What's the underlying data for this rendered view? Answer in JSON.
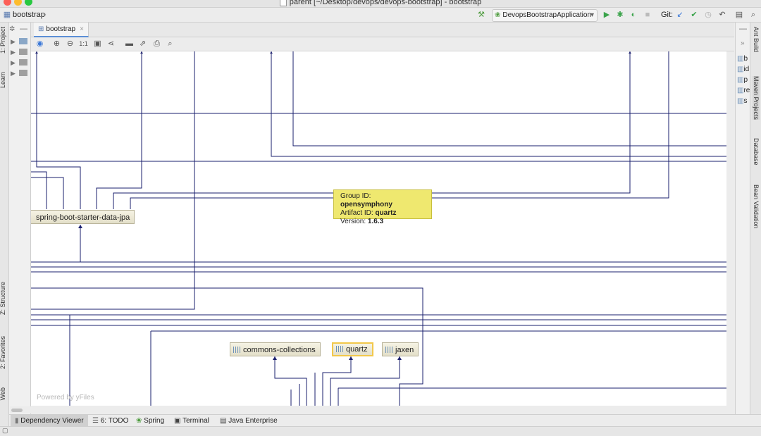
{
  "window": {
    "title": "parent [~/Desktop/devops/devops-bootstrap] - bootstrap",
    "colors": {
      "close": "#fc5f57",
      "minimize": "#fdbc2e",
      "zoom": "#28c840",
      "edge": "#1a1f6e",
      "tooltip": "#efe86f",
      "selected": "#f2c84b"
    }
  },
  "navbar": {
    "breadcrumb": "bootstrap",
    "run_config": "DevopsBootstrapApplication",
    "git_label": "Git:"
  },
  "left_stripe": {
    "project_tab": "1: Project",
    "learn_tab": "Learn",
    "structure_tab": "Z: Structure",
    "favorites_tab": "2: Favorites",
    "web_tab": "Web"
  },
  "right_stripe": {
    "ant_build": "Ant Build",
    "maven_projects": "Maven Projects",
    "database": "Database",
    "bean_validation": "Bean Validation"
  },
  "maven_panel": {
    "items": [
      "b",
      "id",
      "p",
      "re",
      "s"
    ]
  },
  "editor_tabs": [
    {
      "label": "bootstrap"
    }
  ],
  "diagram_toolbar": {
    "actual_size": "1:1"
  },
  "diagram": {
    "nodes": [
      {
        "label": "spring-boot-starter-data-jpa"
      },
      {
        "label": "commons-collections"
      },
      {
        "label": "quartz"
      },
      {
        "label": "jaxen"
      }
    ],
    "tooltip": {
      "group_label": "Group ID:",
      "group_value": "opensymphony",
      "artifact_label": "Artifact ID:",
      "artifact_value": "quartz",
      "version_label": "Version:",
      "version_value": "1.6.3"
    },
    "watermark": "Powered by yFiles"
  },
  "bottom_tabs": [
    {
      "label": "Dependency Viewer"
    },
    {
      "label": "6: TODO"
    },
    {
      "label": "Spring"
    },
    {
      "label": "Terminal"
    },
    {
      "label": "Java Enterprise"
    }
  ]
}
